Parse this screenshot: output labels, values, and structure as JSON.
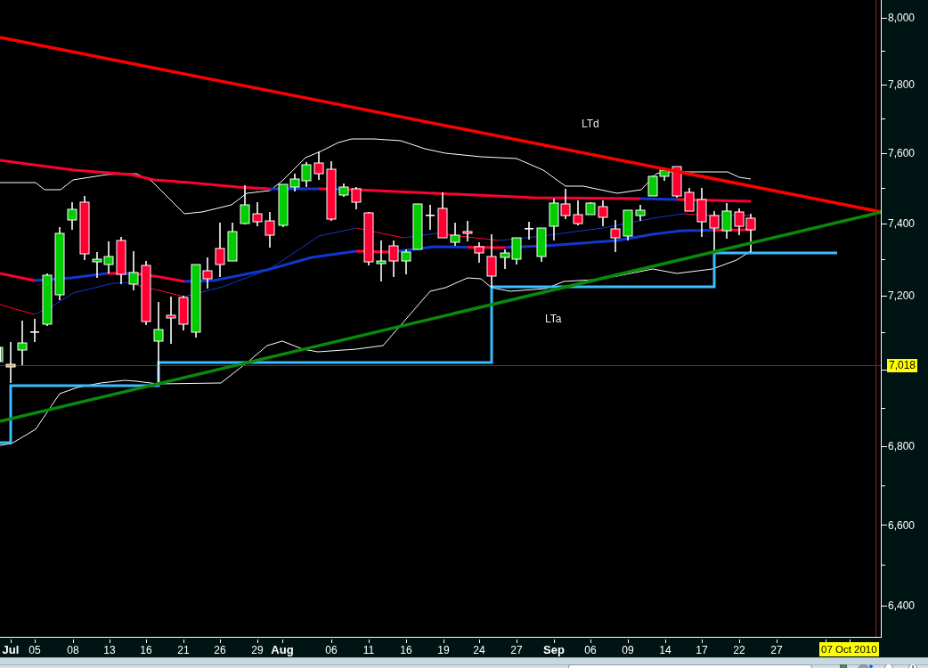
{
  "chart": {
    "trendlines": [
      {
        "label": "LTd",
        "kind": "descending"
      },
      {
        "label": "LTa",
        "kind": "ascending"
      }
    ],
    "price_tag": "7,018",
    "date_tag": "07 Oct 2010"
  },
  "price_axis": {
    "labels": [
      "8,000",
      "7,800",
      "7,600",
      "7,400",
      "7,200",
      "6,800",
      "6,600",
      "6,400"
    ]
  },
  "date_axis": {
    "labels": [
      {
        "text": "Jul",
        "kind": "month"
      },
      {
        "text": "05",
        "kind": "day"
      },
      {
        "text": "08",
        "kind": "day"
      },
      {
        "text": "13",
        "kind": "day"
      },
      {
        "text": "16",
        "kind": "day"
      },
      {
        "text": "21",
        "kind": "day"
      },
      {
        "text": "26",
        "kind": "day"
      },
      {
        "text": "29",
        "kind": "day"
      },
      {
        "text": "Aug",
        "kind": "month"
      },
      {
        "text": "06",
        "kind": "day"
      },
      {
        "text": "11",
        "kind": "day"
      },
      {
        "text": "16",
        "kind": "day"
      },
      {
        "text": "19",
        "kind": "day"
      },
      {
        "text": "24",
        "kind": "day"
      },
      {
        "text": "27",
        "kind": "day"
      },
      {
        "text": "Sep",
        "kind": "month"
      },
      {
        "text": "06",
        "kind": "day"
      },
      {
        "text": "09",
        "kind": "day"
      },
      {
        "text": "14",
        "kind": "day"
      },
      {
        "text": "17",
        "kind": "day"
      },
      {
        "text": "22",
        "kind": "day"
      },
      {
        "text": "27",
        "kind": "day"
      }
    ]
  }
}
